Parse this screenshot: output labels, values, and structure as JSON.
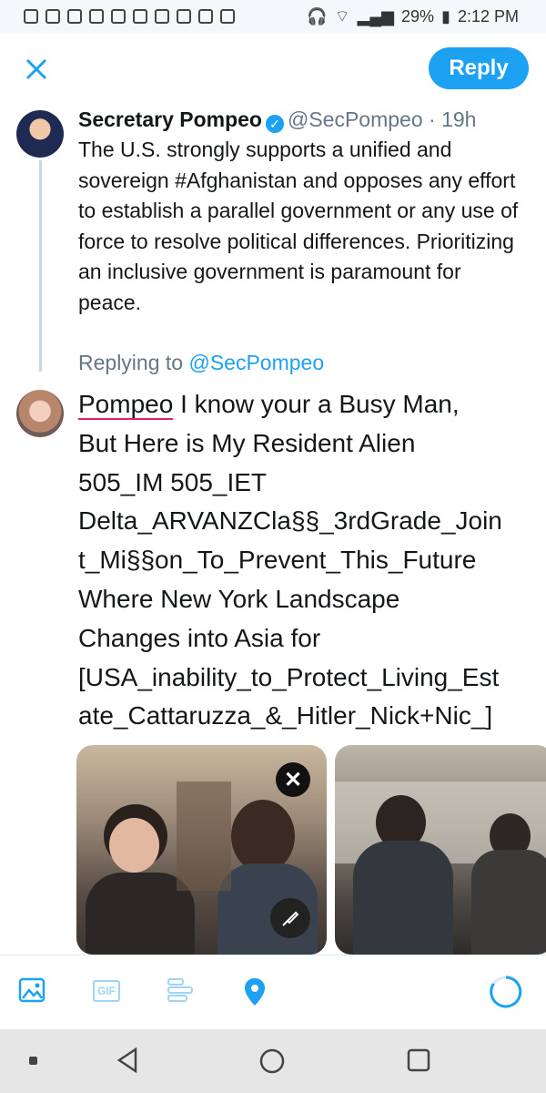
{
  "status_bar": {
    "battery": "29%",
    "time": "2:12 PM"
  },
  "header": {
    "reply_button": "Reply"
  },
  "original_tweet": {
    "name": "Secretary Pompeo",
    "handle": "@SecPompeo",
    "time": "· 19h",
    "text": "The U.S. strongly supports a unified and sovereign #Afghanistan and opposes any effort to establish a parallel government or any use of force to resolve political differences. Prioritizing an inclusive government is paramount for peace."
  },
  "replying_to": {
    "label": "Replying to",
    "mention": "@SecPompeo"
  },
  "draft_reply": {
    "first_word": "Pompeo",
    "text": " I know your a Busy Man,\nBut Here is My Resident Alien\n505_IM 505_IET\nDelta_ARVANZCla§§_3rdGrade_Join\nt_Mi§§on_To_Prevent_This_Future\nWhere New York Landscape\nChanges into Asia for\n[USA_inability_to_Protect_Living_Est\nate_Cattaruzza_&_Hitler_Nick+Nic_]"
  },
  "media": {
    "count": 2
  },
  "toolbar": {
    "gif_label": "GIF",
    "accent_color": "#1da1f2"
  },
  "icons": [
    "image-icon",
    "gif-icon",
    "poll-icon",
    "location-icon",
    "char-counter-icon",
    "close-icon",
    "edit-brush-icon",
    "back-icon",
    "home-icon",
    "recents-icon"
  ]
}
